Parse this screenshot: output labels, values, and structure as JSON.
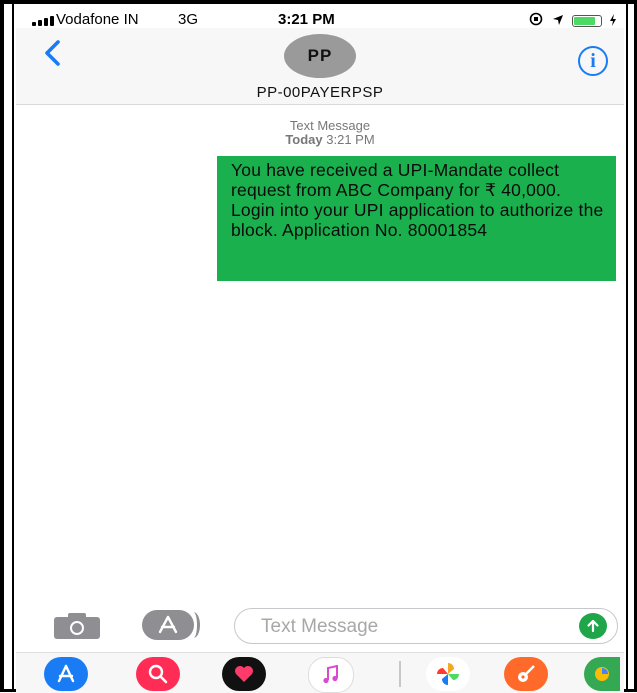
{
  "status_bar": {
    "carrier": "Vodafone IN",
    "network": "3G",
    "time": "3:21 PM"
  },
  "header": {
    "avatar_initials": "PP",
    "contact_name": "PP-00PAYERPSP",
    "info_glyph": "i"
  },
  "thread": {
    "meta_label": "Text Message",
    "meta_day": "Today",
    "meta_time": "3:21 PM",
    "message": "You have received a UPI-Mandate collect request from ABC Company for ₹ 40,000. Login into your UPI application to authorize the block. Application No. 80001854"
  },
  "composer": {
    "placeholder": "Text Message"
  },
  "icons": [
    "back-chevron-icon",
    "info-icon",
    "camera-icon",
    "app-store-icon",
    "send-arrow-icon",
    "search-icon",
    "heart-icon",
    "music-note-icon",
    "pinwheel-icon",
    "guitar-icon",
    "maps-icon"
  ],
  "colors": {
    "accent": "#1a7cf5",
    "bubble": "#1ab04e",
    "send": "#1fa64a"
  }
}
